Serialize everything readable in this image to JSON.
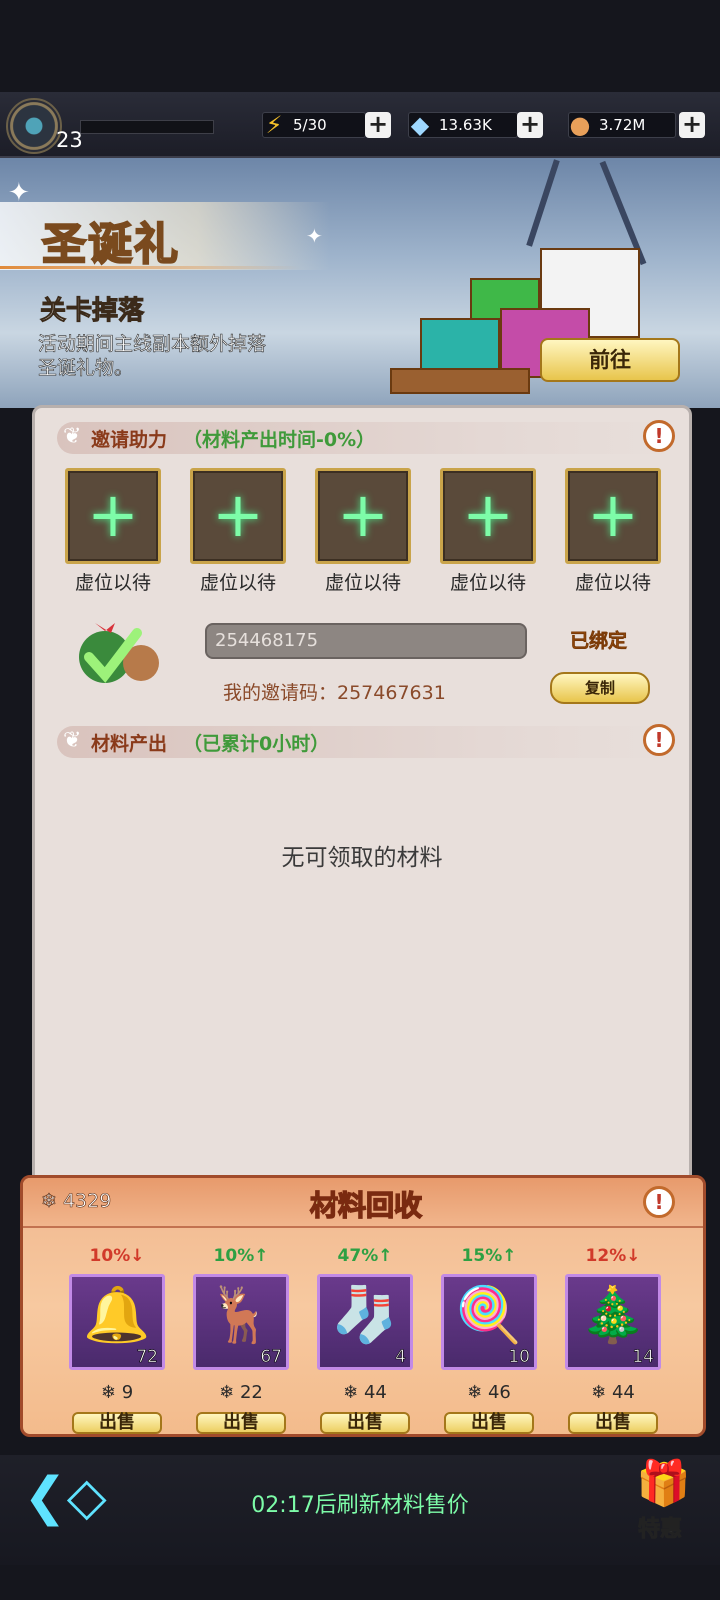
{
  "player": {
    "level": "23"
  },
  "resources": [
    {
      "icon": "lightning-icon",
      "value": "5/30"
    },
    {
      "icon": "crystal-icon",
      "value": "13.63K"
    },
    {
      "icon": "coin-icon",
      "value": "3.72M"
    }
  ],
  "banner": {
    "title": "圣诞礼",
    "subtitle": "关卡掉落",
    "description": "活动期间主线副本额外掉落圣诞礼物。",
    "goto_label": "前往"
  },
  "invite": {
    "header": "邀请助力",
    "header_note": "（材料产出时间-0%）",
    "slots": [
      "虚位以待",
      "虚位以待",
      "虚位以待",
      "虚位以待",
      "虚位以待"
    ],
    "bound_code": "254468175",
    "bound_label": "已绑定",
    "my_code_text": "我的邀请码：257467631",
    "copy_label": "复制"
  },
  "output": {
    "header": "材料产出",
    "header_note": "（已累计0小时）",
    "empty_text": "无可领取的材料"
  },
  "recycle": {
    "title": "材料回收",
    "snow_count": "4329",
    "items": [
      {
        "name": "bell-icon",
        "glyph": "🔔",
        "change": "10%↓",
        "trend": "down",
        "qty": "72",
        "price": "9",
        "sell": "出售"
      },
      {
        "name": "reindeer-icon",
        "glyph": "🦌",
        "change": "10%↑",
        "trend": "up",
        "qty": "67",
        "price": "22",
        "sell": "出售"
      },
      {
        "name": "stocking-icon",
        "glyph": "🧦",
        "change": "47%↑",
        "trend": "up",
        "qty": "4",
        "price": "44",
        "sell": "出售"
      },
      {
        "name": "candy-cane-icon",
        "glyph": "🍭",
        "change": "15%↑",
        "trend": "up",
        "qty": "10",
        "price": "46",
        "sell": "出售"
      },
      {
        "name": "wreath-icon",
        "glyph": "🎄",
        "change": "12%↓",
        "trend": "down",
        "qty": "14",
        "price": "44",
        "sell": "出售"
      }
    ]
  },
  "footer": {
    "timer_text": "02:17后刷新材料售价",
    "special_label": "特惠"
  },
  "colors": {
    "up": "#2ea043",
    "down": "#d13a2a",
    "accent": "#c26a2c"
  }
}
